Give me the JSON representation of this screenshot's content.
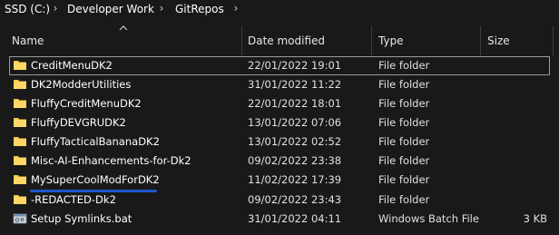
{
  "breadcrumb": {
    "items": [
      "SSD (C:)",
      "Developer Work",
      "GitRepos"
    ],
    "separator": "›"
  },
  "columns": {
    "name": "Name",
    "date_modified": "Date modified",
    "type": "Type",
    "size": "Size"
  },
  "files": [
    {
      "name": "CreditMenuDK2",
      "date": "22/01/2022 19:01",
      "type": "File folder",
      "size": "",
      "icon": "folder-icon"
    },
    {
      "name": "DK2ModderUtilities",
      "date": "31/01/2022 11:22",
      "type": "File folder",
      "size": "",
      "icon": "folder-icon"
    },
    {
      "name": "FluffyCreditMenuDK2",
      "date": "22/01/2022 18:01",
      "type": "File folder",
      "size": "",
      "icon": "folder-icon"
    },
    {
      "name": "FluffyDEVGRUDK2",
      "date": "13/01/2022 07:06",
      "type": "File folder",
      "size": "",
      "icon": "folder-icon"
    },
    {
      "name": "FluffyTacticalBananaDK2",
      "date": "13/01/2022 02:52",
      "type": "File folder",
      "size": "",
      "icon": "folder-icon"
    },
    {
      "name": "Misc-AI-Enhancements-for-Dk2",
      "date": "09/02/2022 23:38",
      "type": "File folder",
      "size": "",
      "icon": "folder-icon"
    },
    {
      "name": "MySuperCoolModForDK2",
      "date": "11/02/2022 17:39",
      "type": "File folder",
      "size": "",
      "icon": "folder-icon"
    },
    {
      "name": "-REDACTED-Dk2",
      "date": "09/02/2022 23:43",
      "type": "File folder",
      "size": "",
      "icon": "folder-icon"
    },
    {
      "name": "Setup Symlinks.bat",
      "date": "31/01/2022 04:11",
      "type": "Windows Batch File",
      "size": "3 KB",
      "icon": "batch-file-icon"
    }
  ],
  "colors": {
    "background": "#191919",
    "folder": "#f5c648",
    "selection_border": "#9a9a9a",
    "underline": "#1e56c8"
  }
}
